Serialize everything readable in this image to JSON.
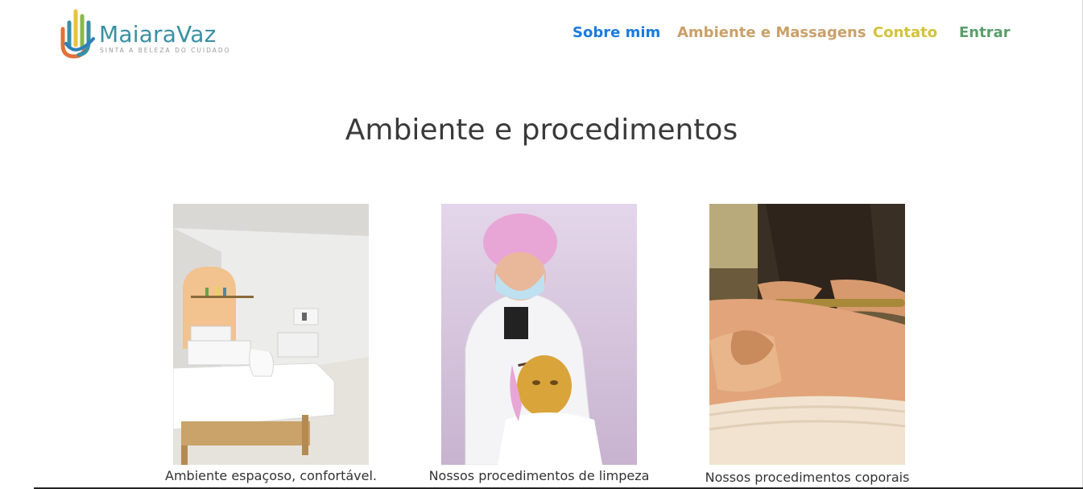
{
  "brand": {
    "name": "MaiaraVaz",
    "tagline": "SINTA A BELEZA DO CUIDADO"
  },
  "nav": {
    "items": [
      {
        "label": "Sobre mim",
        "color": "#1a7be0"
      },
      {
        "label": "Ambiente e Massagens",
        "color": "#c9a06a"
      },
      {
        "label": "Contato",
        "color": "#d4c23a"
      },
      {
        "label": "Entrar",
        "color": "#5b9e6b"
      }
    ]
  },
  "main": {
    "title": "Ambiente e procedimentos",
    "cards": [
      {
        "caption": "Ambiente espaçoso, confortável.",
        "image": "massage-room-photo"
      },
      {
        "caption": "Nossos procedimentos de limpeza",
        "image": "facial-treatment-photo"
      },
      {
        "caption": "Nossos procedimentos coporais",
        "image": "body-massage-photo"
      }
    ]
  },
  "colors": {
    "logo_text": "#3a8fa3",
    "title": "#3a3a3a"
  }
}
